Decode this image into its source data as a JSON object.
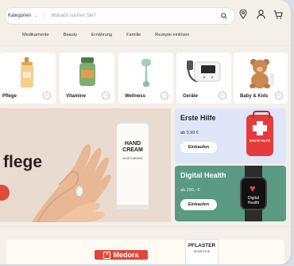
{
  "header": {
    "category_select": "Kategorien",
    "search_placeholder": "Wonach suchen Sie?"
  },
  "nav": [
    "Medikamente",
    "Beauty",
    "Ernährung",
    "Familie",
    "Rezepte einlösen"
  ],
  "categories": [
    {
      "label": "Pflege"
    },
    {
      "label": "Vitamine"
    },
    {
      "label": "Wellness"
    },
    {
      "label": "Geräte"
    },
    {
      "label": "Baby & Kids"
    }
  ],
  "hero": {
    "headline": "flege",
    "product_line1": "HAND",
    "product_line2": "CREAM",
    "product_line3": "MOISTURIZING"
  },
  "promos": [
    {
      "title": "Erste Hilfe",
      "price": "ab 9,99 €",
      "button": "Einkaufen",
      "kit_label": "ERSTE HILFE"
    },
    {
      "title": "Digital Health",
      "price": "ab 299,- €",
      "button": "Einkaufen",
      "watch_label_1": "Digital",
      "watch_label_2": "Health"
    }
  ],
  "bottom": {
    "brand": "Medora",
    "product_title": "PFLASTER",
    "product_sub": "SENSITIVE"
  },
  "colors": {
    "background": "#f5efe9",
    "promo_blue": "#dfe6f7",
    "promo_green": "#5a9a84",
    "accent_red": "#e2453a"
  }
}
